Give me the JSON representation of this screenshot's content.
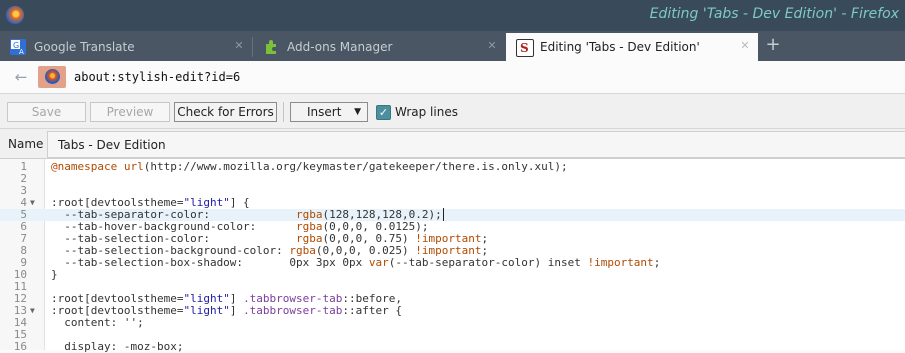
{
  "window": {
    "title": "Editing 'Tabs - Dev Edition' - Firefox"
  },
  "tabs": [
    {
      "label": "Google Translate",
      "icon": "translate-icon",
      "close": "✕"
    },
    {
      "label": "Add-ons Manager",
      "icon": "puzzle-icon",
      "close": "✕"
    },
    {
      "label": "Editing 'Tabs - Dev Edition'",
      "icon": "stylish-icon",
      "close": "✕"
    }
  ],
  "newtab": "+",
  "nav": {
    "back": "←",
    "url": "about:stylish-edit?id=6"
  },
  "toolbar": {
    "save": "Save",
    "preview": "Preview",
    "check": "Check for Errors",
    "insert": "Insert",
    "insert_caret": "▼",
    "wrap_check": "✓",
    "wrap": "Wrap lines"
  },
  "name": {
    "label": "Name",
    "value": "Tabs - Dev Edition"
  },
  "editor": {
    "lines": [
      {
        "no": "1",
        "fold": "",
        "code": "@namespace url(http://www.mozilla.org/keymaster/gatekeeper/there.is.only.xul);"
      },
      {
        "no": "2",
        "fold": "",
        "code": ""
      },
      {
        "no": "3",
        "fold": "",
        "code": ""
      },
      {
        "no": "4",
        "fold": "▼",
        "code": ":root[devtoolstheme=\"light\"] {"
      },
      {
        "no": "5",
        "fold": "",
        "code": "  --tab-separator-color:             rgba(128,128,128,0.2);"
      },
      {
        "no": "6",
        "fold": "",
        "code": "  --tab-hover-background-color:      rgba(0,0,0, 0.0125);"
      },
      {
        "no": "7",
        "fold": "",
        "code": "  --tab-selection-color:             rgba(0,0,0, 0.75) !important;"
      },
      {
        "no": "8",
        "fold": "",
        "code": "  --tab-selection-background-color: rgba(0,0,0, 0.025) !important;"
      },
      {
        "no": "9",
        "fold": "",
        "code": "  --tab-selection-box-shadow:       0px 3px 0px var(--tab-separator-color) inset !important;"
      },
      {
        "no": "10",
        "fold": "",
        "code": "}"
      },
      {
        "no": "11",
        "fold": "",
        "code": ""
      },
      {
        "no": "12",
        "fold": "",
        "code": ":root[devtoolstheme=\"light\"] .tabbrowser-tab::before,"
      },
      {
        "no": "13",
        "fold": "▼",
        "code": ":root[devtoolstheme=\"light\"] .tabbrowser-tab::after {"
      },
      {
        "no": "14",
        "fold": "",
        "code": "  content: '';"
      },
      {
        "no": "15",
        "fold": "",
        "code": ""
      },
      {
        "no": "16",
        "fold": "",
        "code": "  display: -moz-box;"
      }
    ]
  },
  "colors": {
    "titlebar": "#394b5b",
    "tabstrip": "#4a5663",
    "title_text": "#7ec9c6",
    "checkbox": "#4e8f9e"
  }
}
